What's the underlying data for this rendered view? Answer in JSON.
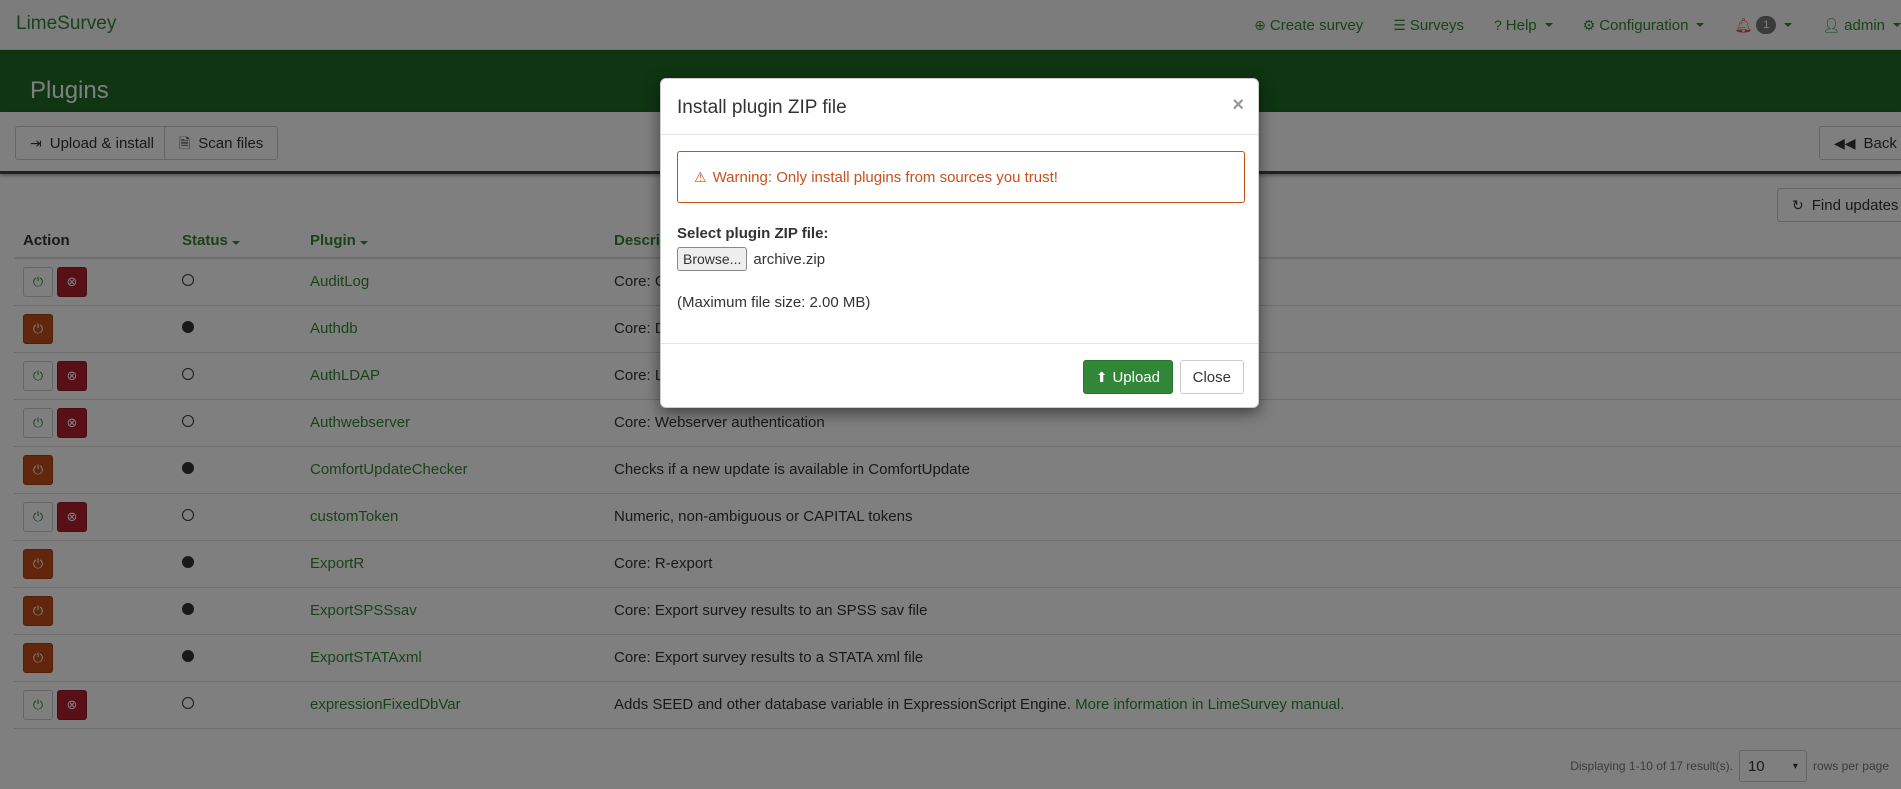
{
  "app": {
    "brand": "LimeSurvey"
  },
  "nav": {
    "create_survey": "Create survey",
    "surveys": "Surveys",
    "help": "Help",
    "configuration": "Configuration",
    "notifications_count": "1",
    "user": "admin"
  },
  "page": {
    "title": "Plugins"
  },
  "toolbar": {
    "upload_install": "Upload & install",
    "scan_files": "Scan files",
    "back": "Back",
    "find_updates": "Find updates"
  },
  "table": {
    "headers": {
      "action": "Action",
      "status": "Status",
      "plugin": "Plugin",
      "description": "Descrip"
    },
    "rows": [
      {
        "name": "AuditLog",
        "status": "inactive",
        "description": "Core: C",
        "link": ""
      },
      {
        "name": "Authdb",
        "status": "active",
        "description": "Core: D",
        "link": ""
      },
      {
        "name": "AuthLDAP",
        "status": "inactive",
        "description": "Core: L",
        "link": ""
      },
      {
        "name": "Authwebserver",
        "status": "inactive",
        "description": "Core: Webserver authentication",
        "link": ""
      },
      {
        "name": "ComfortUpdateChecker",
        "status": "active",
        "description": "Checks if a new update is available in ComfortUpdate",
        "link": ""
      },
      {
        "name": "customToken",
        "status": "inactive",
        "description": "Numeric, non-ambiguous or CAPITAL tokens",
        "link": ""
      },
      {
        "name": "ExportR",
        "status": "active",
        "description": "Core: R-export",
        "link": ""
      },
      {
        "name": "ExportSPSSsav",
        "status": "active",
        "description": "Core: Export survey results to an SPSS sav file",
        "link": ""
      },
      {
        "name": "ExportSTATAxml",
        "status": "active",
        "description": "Core: Export survey results to a STATA xml file",
        "link": ""
      },
      {
        "name": "expressionFixedDbVar",
        "status": "inactive",
        "description": "Adds SEED and other database variable in ExpressionScript Engine. ",
        "link": "More information in LimeSurvey manual."
      }
    ]
  },
  "pager": {
    "summary": "Displaying 1-10 of 17 result(s).",
    "rows_per_page_value": "10",
    "rows_per_page_label": "rows per page"
  },
  "modal": {
    "title": "Install plugin ZIP file",
    "close_x": "×",
    "warning": "Warning: Only install plugins from sources you trust!",
    "select_label": "Select plugin ZIP file:",
    "browse_label": "Browse...",
    "file_name": "archive.zip",
    "max_size": "(Maximum file size: 2.00 MB)",
    "upload_label": "Upload",
    "close_label": "Close"
  },
  "colors": {
    "brand_green": "#328637",
    "header_green": "#1f6a25",
    "warning_orange": "#c8501a",
    "deactivate_orange": "#c24d16",
    "uninstall_red": "#b21f2d"
  },
  "icons": {
    "create_survey": "plus-circle-icon",
    "surveys": "list-icon",
    "help": "question-circle-icon",
    "configuration": "cogs-icon",
    "notifications": "bell-icon",
    "user": "user-icon",
    "upload_install": "sign-in-icon",
    "scan_files": "file-search-icon",
    "back": "backward-icon",
    "find_updates": "refresh-icon",
    "activate": "power-icon",
    "uninstall": "times-circle-icon",
    "warning": "warning-icon",
    "upload": "upload-icon"
  }
}
